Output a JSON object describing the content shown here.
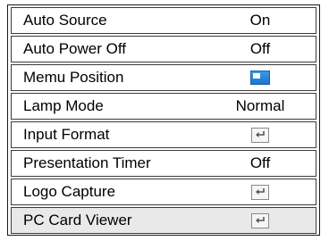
{
  "menu": {
    "items": [
      {
        "label": "Auto Source",
        "value": "On"
      },
      {
        "label": "Auto Power Off",
        "value": "Off"
      },
      {
        "label": "Memu Position",
        "icon": "menu-position-icon"
      },
      {
        "label": "Lamp Mode",
        "value": "Normal"
      },
      {
        "label": "Input Format",
        "icon": "enter-icon"
      },
      {
        "label": "Presentation Timer",
        "value": "Off"
      },
      {
        "label": "Logo Capture",
        "icon": "enter-icon"
      },
      {
        "label": "PC Card Viewer",
        "icon": "enter-icon"
      }
    ]
  },
  "colors": {
    "border": "#3a3a3a",
    "selected_row": "#e9e9e9",
    "position_icon": "#1876d0"
  }
}
